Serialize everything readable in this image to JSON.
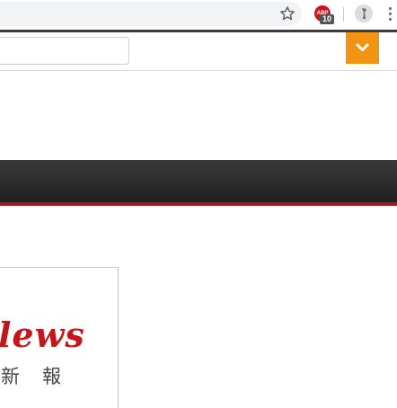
{
  "browser": {
    "extension": {
      "label": "ABP",
      "badge_count": "10"
    }
  },
  "site": {
    "search": {
      "value": "",
      "placeholder": ""
    }
  },
  "logo": {
    "wordmark": "lews",
    "subtitle": "新　報"
  },
  "colors": {
    "accent": "#f39314",
    "brand_red": "#c4161c",
    "nav_dark": "#2a2a2a",
    "nav_line": "#9c1b1b"
  },
  "icons": {
    "bookmark": "star-icon",
    "extension": "adblock-icon",
    "profile": "avatar",
    "menu": "more-vert-icon",
    "dropdown": "chevron-down-icon"
  }
}
